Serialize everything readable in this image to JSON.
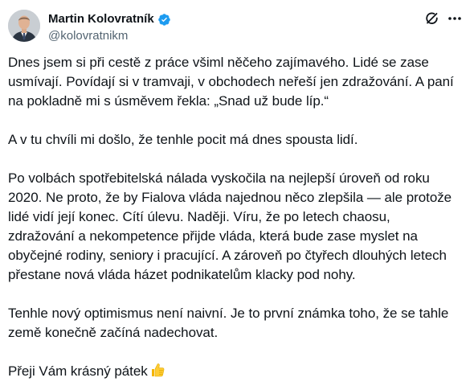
{
  "author": {
    "display_name": "Martin Kolovratník",
    "handle": "@kolovratnikm",
    "verified": true,
    "verified_color": "#1d9bf0"
  },
  "actions": {
    "grok_icon": "grok-icon",
    "more_icon": "more-icon"
  },
  "tweet": {
    "paragraphs": [
      {
        "lines": [
          "Dnes jsem si při cestě z práce všiml něčeho zajímavého. Lidé se zase",
          "usmívají. Povídají si v tramvaji, v obchodech neřeší jen zdražování. A paní",
          "na pokladně mi s úsměvem řekla: „Snad už bude líp.“"
        ]
      },
      {
        "lines": [
          "A v tu chvíli mi došlo, že tenhle pocit má dnes spousta lidí."
        ]
      },
      {
        "lines": [
          "Po volbách spotřebitelská nálada vyskočila na nejlepší úroveň od roku",
          "2020. Ne proto, že by Fialova vláda najednou něco zlepšila — ale protože",
          "lidé vidí její konec. Cítí úlevu. Naději. Víru, že po letech chaosu,",
          "zdražování a nekompetence přijde vláda, která bude zase myslet na",
          "obyčejné rodiny, seniory i pracující. A zároveň po čtyřech dlouhých letech",
          "přestane nová vláda házet podnikatelům klacky pod nohy."
        ]
      },
      {
        "lines": [
          "Tenhle nový optimismus není naivní. Je to první známka toho, že se tahle",
          "země konečně začíná nadechovat."
        ]
      },
      {
        "lines": [
          "Přeji Vám krásný pátek"
        ],
        "trailing_emoji": "thumbs-up"
      }
    ]
  },
  "colors": {
    "text": "#0f1419",
    "secondary": "#536471",
    "accent": "#1d9bf0",
    "emoji": "#f4c430"
  }
}
